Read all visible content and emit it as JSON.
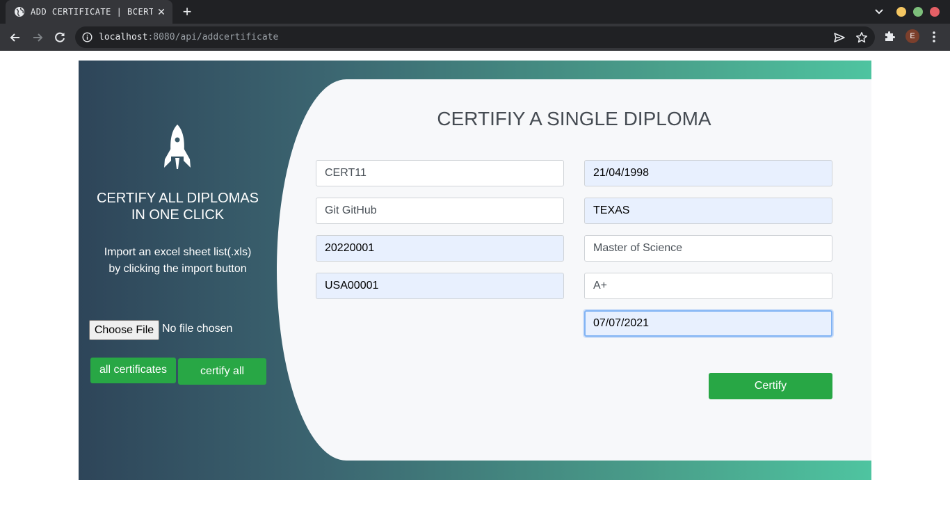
{
  "browser": {
    "tab_title": "ADD CERTIFICATE | BCERT",
    "tab_close": "✕",
    "new_tab": "+",
    "url_host": "localhost",
    "url_path": ":8080/api/addcertificate",
    "profile_initial": "E"
  },
  "sidebar": {
    "heading_line1": "CERTIFY ALL DIPLOMAS",
    "heading_line2": "IN ONE CLICK",
    "desc_line1": "Import an excel sheet list(.xls)",
    "desc_line2": "by clicking the import button",
    "choose_file_label": "Choose File",
    "file_status": "No file chosen",
    "all_certificates_label": "all certificates",
    "certify_all_label": "certify all"
  },
  "form": {
    "title": "CERTIFIY A SINGLE DIPLOMA",
    "fields": [
      {
        "value": "CERT11",
        "autofilled": false
      },
      {
        "value": "21/04/1998",
        "autofilled": true
      },
      {
        "value": "Git GitHub",
        "autofilled": false
      },
      {
        "value": "TEXAS",
        "autofilled": true
      },
      {
        "value": "20220001",
        "autofilled": true
      },
      {
        "value": "Master of Science",
        "autofilled": false
      },
      {
        "value": "USA00001",
        "autofilled": true
      },
      {
        "value": "A+",
        "autofilled": false
      },
      {
        "value": "07/07/2021",
        "autofilled": true,
        "focused": true
      }
    ],
    "certify_label": "Certify"
  },
  "icons": {
    "favicon": "globe-icon",
    "rocket": "rocket-icon",
    "back": "arrow-left-icon",
    "forward": "arrow-right-icon",
    "reload": "reload-icon",
    "info": "info-icon",
    "send": "send-icon",
    "bookmark": "star-icon",
    "extensions": "puzzle-icon",
    "menu": "kebab-icon"
  },
  "colors": {
    "accent_green": "#28a745",
    "gradient_start": "#2e4559",
    "gradient_end": "#4ec4a0",
    "autofill_bg": "#e8f0fe",
    "focus_ring": "#80b3f4"
  }
}
